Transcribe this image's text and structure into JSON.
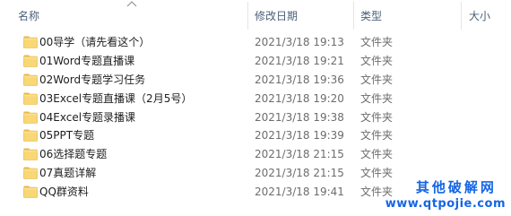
{
  "columns": {
    "name": "名称",
    "date_modified": "修改日期",
    "type": "类型",
    "size": "大小"
  },
  "rows": [
    {
      "name": "00导学（请先看这个）",
      "date": "2021/3/18 19:13",
      "type": "文件夹",
      "icon": "folder-icon"
    },
    {
      "name": "01Word专题直播课",
      "date": "2021/3/18 19:21",
      "type": "文件夹",
      "icon": "folder-icon"
    },
    {
      "name": "02Word专题学习任务",
      "date": "2021/3/18 19:36",
      "type": "文件夹",
      "icon": "folder-icon"
    },
    {
      "name": "03Excel专题直播课（2月5号）",
      "date": "2021/3/18 19:20",
      "type": "文件夹",
      "icon": "folder-icon"
    },
    {
      "name": "04Excel专题录播课",
      "date": "2021/3/18 19:38",
      "type": "文件夹",
      "icon": "folder-icon"
    },
    {
      "name": "05PPT专题",
      "date": "2021/3/18 19:39",
      "type": "文件夹",
      "icon": "folder-icon"
    },
    {
      "name": "06选择题专题",
      "date": "2021/3/18 21:15",
      "type": "文件夹",
      "icon": "folder-icon"
    },
    {
      "name": "07真题详解",
      "date": "2021/3/18 21:15",
      "type": "文件夹",
      "icon": "folder-icon"
    },
    {
      "name": "QQ群资料",
      "date": "2021/3/18 19:41",
      "type": "文件夹",
      "icon": "folder-icon"
    }
  ],
  "watermark": {
    "line1": "其他破解网",
    "line2": "www.qtpojie.com"
  },
  "colors": {
    "header_text": "#4c607a",
    "folder_fill": "#f8d775",
    "folder_tab": "#e8b946",
    "meta_text": "#6d6d6d",
    "watermark": "#1565e5"
  }
}
